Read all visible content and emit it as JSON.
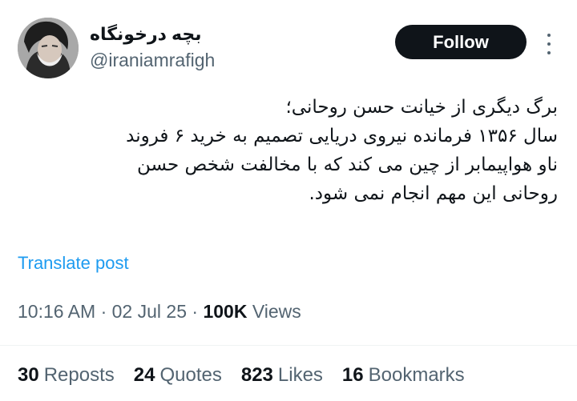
{
  "author": {
    "display_name": "بچه درخونگاه",
    "handle": "@iraniamrafigh"
  },
  "follow_label": "Follow",
  "more_icon": "more-horizontal-icon",
  "tweet_lines": [
    "برگ دیگری از خیانت حسن روحانی؛",
    "سال ۱۳۵۶ فرمانده نیروی دریایی تصمیم به خرید ۶ فروند",
    "ناو هواپیمابر از چین می کند که با مخالفت شخص حسن",
    "روحانی این مهم انجام نمی شود."
  ],
  "translate_label": "Translate post",
  "meta": {
    "time": "10:16 AM",
    "sep1": " · ",
    "date": "02 Jul 25",
    "sep2": " · ",
    "views_count": "100K",
    "views_label": " Views"
  },
  "stats": {
    "reposts_count": "30",
    "reposts_label": "Reposts",
    "quotes_count": "24",
    "quotes_label": "Quotes",
    "likes_count": "823",
    "likes_label": "Likes",
    "bookmarks_count": "16",
    "bookmarks_label": "Bookmarks"
  },
  "colors": {
    "accent": "#1d9bf0",
    "text": "#0f1419",
    "secondary": "#536471",
    "button": "#0f1419"
  }
}
